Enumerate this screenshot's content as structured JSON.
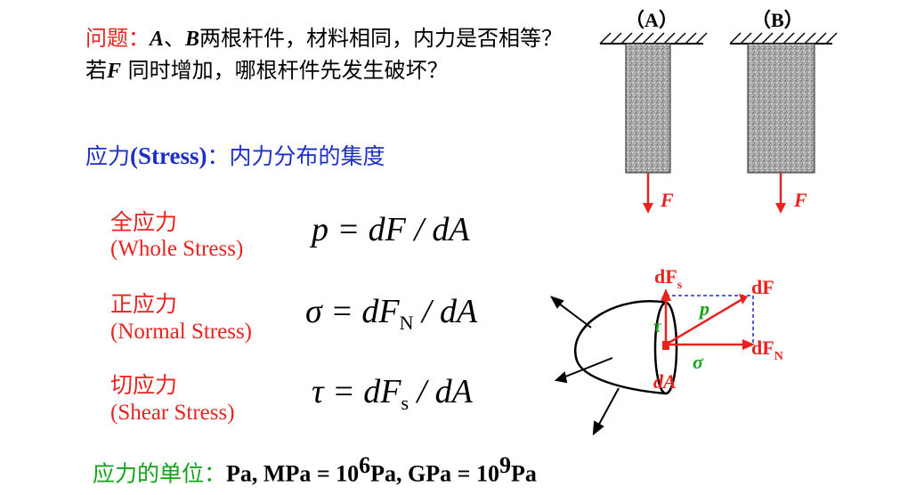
{
  "question": {
    "label": "问题：",
    "a": "A",
    "sep": "、",
    "b": "B",
    "t1": "两根杆件，材料相同，内力是否相等？若",
    "f": "F",
    "t2": " 同时增加，哪根杆件先发生破坏？"
  },
  "stress_def": {
    "zh": "应力",
    "en": "(Stress)",
    "desc": "：内力分布的集度"
  },
  "stress_types": [
    {
      "zh": "全应力",
      "en": "(Whole Stress)",
      "sym": "p",
      "eq": " = dF / dA",
      "sub": ""
    },
    {
      "zh": "正应力",
      "en": "(Normal Stress)",
      "sym": "σ",
      "eq": " = dF",
      "sub": "N",
      "tail": " / dA"
    },
    {
      "zh": "切应力",
      "en": "(Shear Stress)",
      "sym": "τ",
      "eq": " = dF",
      "sub": "s",
      "tail": " / dA"
    }
  ],
  "units": {
    "label": "应力的单位：",
    "pa": "Pa, ",
    "mpa": "MPa = 10",
    "mpa_exp": "6",
    "mpa_u": "Pa, ",
    "gpa": "GPa = 10",
    "gpa_exp": "9",
    "gpa_u": "Pa"
  },
  "bars": {
    "a_label": "（A）",
    "b_label": "（B）",
    "force": "F"
  },
  "diagram": {
    "dFs": "dF",
    "dFs_sub": "s",
    "dF": "dF",
    "p": "p",
    "tau": "τ",
    "dFN": "dF",
    "dFN_sub": "N",
    "sigma": "σ",
    "dA": "dA"
  },
  "colors": {
    "red": "#e8231f",
    "blue": "#1c2fc9",
    "green": "#15a31b"
  }
}
